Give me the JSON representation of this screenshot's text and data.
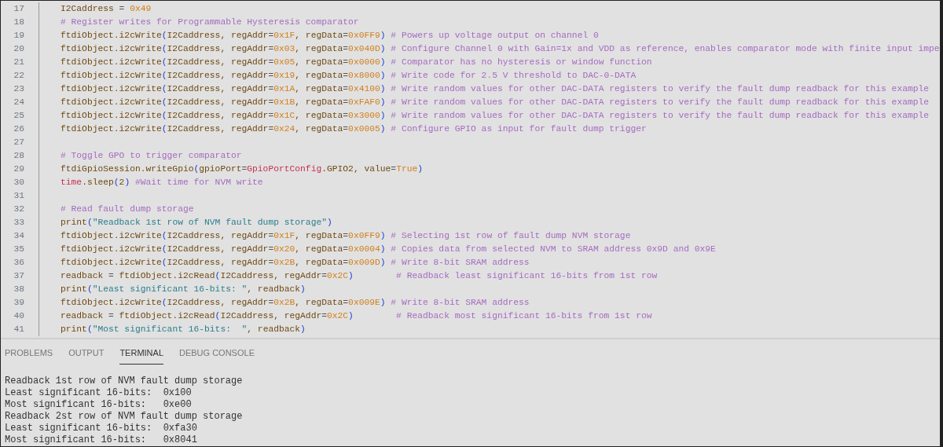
{
  "editor": {
    "lines": [
      {
        "number": "17",
        "tokens": [
          {
            "kind": "name",
            "text": "I2Caddress "
          },
          {
            "kind": "op",
            "text": "= "
          },
          {
            "kind": "num",
            "text": "0x49"
          }
        ]
      },
      {
        "number": "18",
        "tokens": [
          {
            "kind": "comment",
            "text": "# Register writes for Programmable Hysteresis comparator"
          }
        ]
      },
      {
        "number": "19",
        "tokens": [
          {
            "kind": "name",
            "text": "ftdiObject.i2cWrite"
          },
          {
            "kind": "paren",
            "text": "("
          },
          {
            "kind": "name",
            "text": "I2Caddress, regAddr"
          },
          {
            "kind": "op",
            "text": "="
          },
          {
            "kind": "num",
            "text": "0x1F"
          },
          {
            "kind": "name",
            "text": ", regData"
          },
          {
            "kind": "op",
            "text": "="
          },
          {
            "kind": "num",
            "text": "0x0FF9"
          },
          {
            "kind": "paren",
            "text": ")"
          },
          {
            "kind": "comment",
            "text": " # Powers up voltage output on channel 0"
          }
        ]
      },
      {
        "number": "20",
        "tokens": [
          {
            "kind": "name",
            "text": "ftdiObject.i2cWrite"
          },
          {
            "kind": "paren",
            "text": "("
          },
          {
            "kind": "name",
            "text": "I2Caddress, regAddr"
          },
          {
            "kind": "op",
            "text": "="
          },
          {
            "kind": "num",
            "text": "0x03"
          },
          {
            "kind": "name",
            "text": ", regData"
          },
          {
            "kind": "op",
            "text": "="
          },
          {
            "kind": "num",
            "text": "0x040D"
          },
          {
            "kind": "paren",
            "text": ")"
          },
          {
            "kind": "comment",
            "text": " # Configure Channel 0 with Gain=1x and VDD as reference, enables comparator mode with finite input impe"
          }
        ]
      },
      {
        "number": "21",
        "tokens": [
          {
            "kind": "name",
            "text": "ftdiObject.i2cWrite"
          },
          {
            "kind": "paren",
            "text": "("
          },
          {
            "kind": "name",
            "text": "I2Caddress, regAddr"
          },
          {
            "kind": "op",
            "text": "="
          },
          {
            "kind": "num",
            "text": "0x05"
          },
          {
            "kind": "name",
            "text": ", regData"
          },
          {
            "kind": "op",
            "text": "="
          },
          {
            "kind": "num",
            "text": "0x0000"
          },
          {
            "kind": "paren",
            "text": ")"
          },
          {
            "kind": "comment",
            "text": " # Comparator has no hysteresis or window function"
          }
        ]
      },
      {
        "number": "22",
        "tokens": [
          {
            "kind": "name",
            "text": "ftdiObject.i2cWrite"
          },
          {
            "kind": "paren",
            "text": "("
          },
          {
            "kind": "name",
            "text": "I2Caddress, regAddr"
          },
          {
            "kind": "op",
            "text": "="
          },
          {
            "kind": "num",
            "text": "0x19"
          },
          {
            "kind": "name",
            "text": ", regData"
          },
          {
            "kind": "op",
            "text": "="
          },
          {
            "kind": "num",
            "text": "0x8000"
          },
          {
            "kind": "paren",
            "text": ")"
          },
          {
            "kind": "comment",
            "text": " # Write code for 2.5 V threshold to DAC-0-DATA"
          }
        ]
      },
      {
        "number": "23",
        "tokens": [
          {
            "kind": "name",
            "text": "ftdiObject.i2cWrite"
          },
          {
            "kind": "paren",
            "text": "("
          },
          {
            "kind": "name",
            "text": "I2Caddress, regAddr"
          },
          {
            "kind": "op",
            "text": "="
          },
          {
            "kind": "num",
            "text": "0x1A"
          },
          {
            "kind": "name",
            "text": ", regData"
          },
          {
            "kind": "op",
            "text": "="
          },
          {
            "kind": "num",
            "text": "0x4100"
          },
          {
            "kind": "paren",
            "text": ")"
          },
          {
            "kind": "comment",
            "text": " # Write random values for other DAC-DATA registers to verify the fault dump readback for this example"
          }
        ]
      },
      {
        "number": "24",
        "tokens": [
          {
            "kind": "name",
            "text": "ftdiObject.i2cWrite"
          },
          {
            "kind": "paren",
            "text": "("
          },
          {
            "kind": "name",
            "text": "I2Caddress, regAddr"
          },
          {
            "kind": "op",
            "text": "="
          },
          {
            "kind": "num",
            "text": "0x1B"
          },
          {
            "kind": "name",
            "text": ", regData"
          },
          {
            "kind": "op",
            "text": "="
          },
          {
            "kind": "num",
            "text": "0xFAF0"
          },
          {
            "kind": "paren",
            "text": ")"
          },
          {
            "kind": "comment",
            "text": " # Write random values for other DAC-DATA registers to verify the fault dump readback for this example"
          }
        ]
      },
      {
        "number": "25",
        "tokens": [
          {
            "kind": "name",
            "text": "ftdiObject.i2cWrite"
          },
          {
            "kind": "paren",
            "text": "("
          },
          {
            "kind": "name",
            "text": "I2Caddress, regAddr"
          },
          {
            "kind": "op",
            "text": "="
          },
          {
            "kind": "num",
            "text": "0x1C"
          },
          {
            "kind": "name",
            "text": ", regData"
          },
          {
            "kind": "op",
            "text": "="
          },
          {
            "kind": "num",
            "text": "0x3000"
          },
          {
            "kind": "paren",
            "text": ")"
          },
          {
            "kind": "comment",
            "text": " # Write random values for other DAC-DATA registers to verify the fault dump readback for this example"
          }
        ]
      },
      {
        "number": "26",
        "tokens": [
          {
            "kind": "name",
            "text": "ftdiObject.i2cWrite"
          },
          {
            "kind": "paren",
            "text": "("
          },
          {
            "kind": "name",
            "text": "I2Caddress, regAddr"
          },
          {
            "kind": "op",
            "text": "="
          },
          {
            "kind": "num",
            "text": "0x24"
          },
          {
            "kind": "name",
            "text": ", regData"
          },
          {
            "kind": "op",
            "text": "="
          },
          {
            "kind": "num",
            "text": "0x0005"
          },
          {
            "kind": "paren",
            "text": ")"
          },
          {
            "kind": "comment",
            "text": " # Configure GPIO as input for fault dump trigger"
          }
        ]
      },
      {
        "number": "27"
      },
      {
        "number": "28",
        "tokens": [
          {
            "kind": "comment",
            "text": "# Toggle GPO to trigger comparator"
          }
        ]
      },
      {
        "number": "29",
        "tokens": [
          {
            "kind": "name",
            "text": "ftdiGpioSession.writeGpio"
          },
          {
            "kind": "paren",
            "text": "("
          },
          {
            "kind": "name",
            "text": "gpioPort"
          },
          {
            "kind": "op",
            "text": "="
          },
          {
            "kind": "module",
            "text": "GpioPortConfig"
          },
          {
            "kind": "name",
            "text": ".GPIO2, value"
          },
          {
            "kind": "op",
            "text": "="
          },
          {
            "kind": "num",
            "text": "True"
          },
          {
            "kind": "paren",
            "text": ")"
          }
        ]
      },
      {
        "number": "30",
        "tokens": [
          {
            "kind": "module",
            "text": "time"
          },
          {
            "kind": "name",
            "text": ".sleep"
          },
          {
            "kind": "paren",
            "text": "("
          },
          {
            "kind": "plain",
            "text": "2"
          },
          {
            "kind": "paren",
            "text": ")"
          },
          {
            "kind": "comment",
            "text": " #Wait time for NVM write"
          }
        ]
      },
      {
        "number": "31"
      },
      {
        "number": "32",
        "tokens": [
          {
            "kind": "comment",
            "text": "# Read fault dump storage"
          }
        ]
      },
      {
        "number": "33",
        "tokens": [
          {
            "kind": "name",
            "text": "print"
          },
          {
            "kind": "paren",
            "text": "("
          },
          {
            "kind": "str",
            "text": "\"Readback 1st row of NVM fault dump storage\""
          },
          {
            "kind": "paren",
            "text": ")"
          }
        ]
      },
      {
        "number": "34",
        "tokens": [
          {
            "kind": "name",
            "text": "ftdiObject.i2cWrite"
          },
          {
            "kind": "paren",
            "text": "("
          },
          {
            "kind": "name",
            "text": "I2Caddress, regAddr"
          },
          {
            "kind": "op",
            "text": "="
          },
          {
            "kind": "num",
            "text": "0x1F"
          },
          {
            "kind": "name",
            "text": ", regData"
          },
          {
            "kind": "op",
            "text": "="
          },
          {
            "kind": "num",
            "text": "0x0FF9"
          },
          {
            "kind": "paren",
            "text": ")"
          },
          {
            "kind": "comment",
            "text": " # Selecting 1st row of fault dump NVM storage"
          }
        ]
      },
      {
        "number": "35",
        "tokens": [
          {
            "kind": "name",
            "text": "ftdiObject.i2cWrite"
          },
          {
            "kind": "paren",
            "text": "("
          },
          {
            "kind": "name",
            "text": "I2Caddress, regAddr"
          },
          {
            "kind": "op",
            "text": "="
          },
          {
            "kind": "num",
            "text": "0x20"
          },
          {
            "kind": "name",
            "text": ", regData"
          },
          {
            "kind": "op",
            "text": "="
          },
          {
            "kind": "num",
            "text": "0x0004"
          },
          {
            "kind": "paren",
            "text": ")"
          },
          {
            "kind": "comment",
            "text": " # Copies data from selected NVM to SRAM address 0x9D and 0x9E"
          }
        ]
      },
      {
        "number": "36",
        "tokens": [
          {
            "kind": "name",
            "text": "ftdiObject.i2cWrite"
          },
          {
            "kind": "paren",
            "text": "("
          },
          {
            "kind": "name",
            "text": "I2Caddress, regAddr"
          },
          {
            "kind": "op",
            "text": "="
          },
          {
            "kind": "num",
            "text": "0x2B"
          },
          {
            "kind": "name",
            "text": ", regData"
          },
          {
            "kind": "op",
            "text": "="
          },
          {
            "kind": "num",
            "text": "0x009D"
          },
          {
            "kind": "paren",
            "text": ")"
          },
          {
            "kind": "comment",
            "text": " # Write 8-bit SRAM address"
          }
        ]
      },
      {
        "number": "37",
        "tokens": [
          {
            "kind": "name",
            "text": "readback "
          },
          {
            "kind": "op",
            "text": "="
          },
          {
            "kind": "name",
            "text": " ftdiObject.i2cRead"
          },
          {
            "kind": "paren",
            "text": "("
          },
          {
            "kind": "name",
            "text": "I2Caddress, regAddr"
          },
          {
            "kind": "op",
            "text": "="
          },
          {
            "kind": "num",
            "text": "0x2C"
          },
          {
            "kind": "paren",
            "text": ")"
          },
          {
            "kind": "comment",
            "text": "        # Readback least significant 16-bits from 1st row"
          }
        ]
      },
      {
        "number": "38",
        "tokens": [
          {
            "kind": "name",
            "text": "print"
          },
          {
            "kind": "paren",
            "text": "("
          },
          {
            "kind": "str",
            "text": "\"Least significant 16-bits: \""
          },
          {
            "kind": "name",
            "text": ", readback"
          },
          {
            "kind": "paren",
            "text": ")"
          }
        ]
      },
      {
        "number": "39",
        "tokens": [
          {
            "kind": "name",
            "text": "ftdiObject.i2cWrite"
          },
          {
            "kind": "paren",
            "text": "("
          },
          {
            "kind": "name",
            "text": "I2Caddress, regAddr"
          },
          {
            "kind": "op",
            "text": "="
          },
          {
            "kind": "num",
            "text": "0x2B"
          },
          {
            "kind": "name",
            "text": ", regData"
          },
          {
            "kind": "op",
            "text": "="
          },
          {
            "kind": "num",
            "text": "0x009E"
          },
          {
            "kind": "paren",
            "text": ")"
          },
          {
            "kind": "comment",
            "text": " # Write 8-bit SRAM address"
          }
        ]
      },
      {
        "number": "40",
        "tokens": [
          {
            "kind": "name",
            "text": "readback "
          },
          {
            "kind": "op",
            "text": "="
          },
          {
            "kind": "name",
            "text": " ftdiObject.i2cRead"
          },
          {
            "kind": "paren",
            "text": "("
          },
          {
            "kind": "name",
            "text": "I2Caddress, regAddr"
          },
          {
            "kind": "op",
            "text": "="
          },
          {
            "kind": "num",
            "text": "0x2C"
          },
          {
            "kind": "paren",
            "text": ")"
          },
          {
            "kind": "comment",
            "text": "        # Readback most significant 16-bits from 1st row"
          }
        ]
      },
      {
        "number": "41",
        "tokens": [
          {
            "kind": "name",
            "text": "print"
          },
          {
            "kind": "paren",
            "text": "("
          },
          {
            "kind": "str",
            "text": "\"Most significant 16-bits:  \""
          },
          {
            "kind": "name",
            "text": ", readback"
          },
          {
            "kind": "paren",
            "text": ")"
          }
        ]
      }
    ]
  },
  "panel": {
    "tabs": [
      {
        "label": "PROBLEMS",
        "selected": false
      },
      {
        "label": "OUTPUT",
        "selected": false
      },
      {
        "label": "TERMINAL",
        "selected": true
      },
      {
        "label": "DEBUG CONSOLE",
        "selected": false
      }
    ],
    "terminal_lines": [
      "Readback 1st row of NVM fault dump storage",
      "Least significant 16-bits:  0x100",
      "Most significant 16-bits:   0xe00",
      "Readback 2st row of NVM fault dump storage",
      "Least significant 16-bits:  0xfa30",
      "Most significant 16-bits:   0x8041"
    ]
  }
}
